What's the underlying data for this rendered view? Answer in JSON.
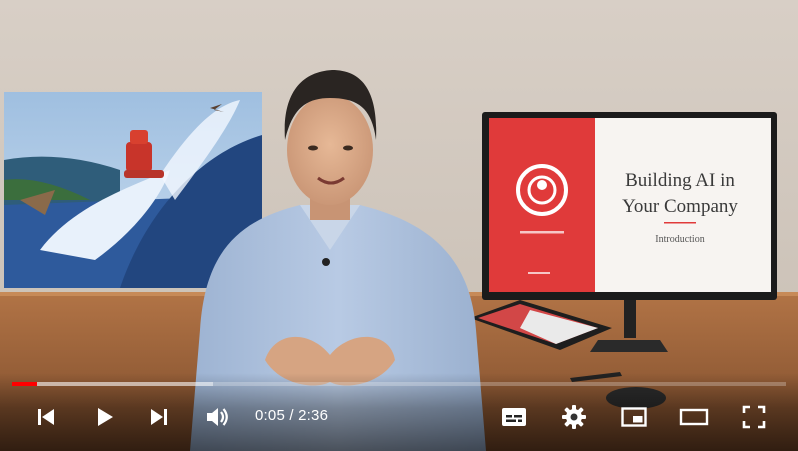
{
  "video": {
    "slide_title_line1": "Building AI in",
    "slide_title_line2": "Your Company",
    "slide_subtitle": "Introduction"
  },
  "player": {
    "progress": {
      "played_fraction": 0.032,
      "buffered_fraction": 0.26,
      "color_played": "#ff0000"
    },
    "time": {
      "current": "0:05",
      "separator": "/",
      "duration": "2:36"
    },
    "controls": {
      "previous_icon": "skip-previous-icon",
      "play_icon": "play-icon",
      "next_icon": "skip-next-icon",
      "volume_icon": "volume-icon",
      "subtitles_icon": "subtitles-icon",
      "settings_icon": "gear-icon",
      "miniplayer_icon": "miniplayer-icon",
      "theater_icon": "theater-mode-icon",
      "fullscreen_icon": "fullscreen-icon"
    }
  }
}
